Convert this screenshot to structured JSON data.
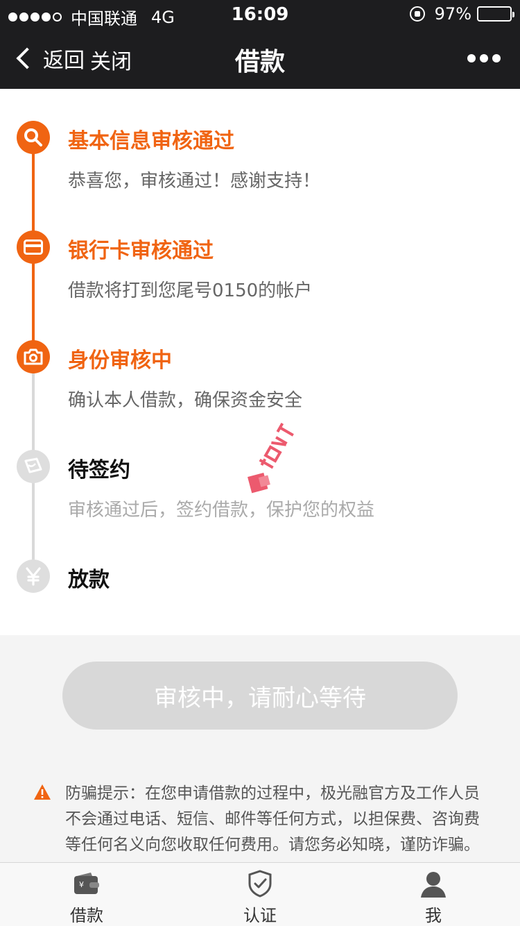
{
  "status_bar": {
    "carrier": "中国联通",
    "network": "4G",
    "time": "16:09",
    "battery": "97%",
    "battery_level": 0.97
  },
  "nav": {
    "back_label": "返回",
    "close_label": "关闭",
    "title": "借款"
  },
  "steps": [
    {
      "title": "基本信息审核通过",
      "desc": "恭喜您，审核通过！感谢支持！",
      "state": "done",
      "icon": "search-icon"
    },
    {
      "title": "银行卡审核通过",
      "desc": "借款将打到您尾号0150的帐户",
      "state": "done",
      "icon": "bank-card-icon"
    },
    {
      "title": "身份审核中",
      "desc": "确认本人借款，确保资金安全",
      "state": "current",
      "icon": "camera-icon"
    },
    {
      "title": "待签约",
      "desc": "审核通过后，签约借款，保护您的权益",
      "state": "pending",
      "icon": "sign-icon"
    },
    {
      "title": "放款",
      "desc": "",
      "state": "pending",
      "icon": "yen-icon"
    }
  ],
  "action_button": "审核中，请耐心等待",
  "warning": {
    "icon": "warning-icon",
    "text": "防骗提示：在您申请借款的过程中，极光融官方及工作人员不会通过电话、短信、邮件等任何方式，以担保费、咨询费等任何名义向您收取任何费用。请您务必知晓，谨防诈骗。"
  },
  "tabs": [
    {
      "label": "借款",
      "icon": "wallet-icon"
    },
    {
      "label": "认证",
      "icon": "shield-check-icon"
    },
    {
      "label": "我",
      "icon": "user-icon"
    }
  ],
  "colors": {
    "accent": "#f06412",
    "navbar": "#1d1d1f",
    "disabled_button": "#d8d8d8"
  }
}
